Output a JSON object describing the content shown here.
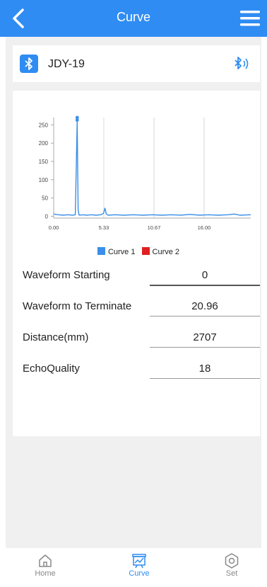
{
  "header": {
    "title": "Curve",
    "back_icon": "chevron-left-icon",
    "menu_icon": "hamburger-menu-icon"
  },
  "device": {
    "name": "JDY-19",
    "icon": "bluetooth-icon",
    "status_icon": "bluetooth-connected-icon"
  },
  "chart_data": {
    "type": "line",
    "title": "",
    "xlabel": "",
    "ylabel": "",
    "x_ticks": [
      "0.00",
      "5.33",
      "10.67",
      "16.00"
    ],
    "y_ticks": [
      "0",
      "50",
      "100",
      "150",
      "200",
      "250"
    ],
    "xlim": [
      0,
      20.96
    ],
    "ylim": [
      -5,
      270
    ],
    "grid": "vertical",
    "legend_position": "bottom-center",
    "series": [
      {
        "name": "Curve 1",
        "color": "#3b8fe8",
        "x": [
          0,
          0.5,
          1.0,
          1.5,
          2.0,
          2.3,
          2.5,
          2.6,
          2.7,
          2.8,
          2.9,
          3.1,
          3.5,
          4.0,
          4.5,
          5.0,
          5.3,
          5.45,
          5.6,
          5.8,
          6.5,
          7.5,
          8.5,
          9.5,
          10.5,
          11.5,
          12.5,
          13.5,
          14.5,
          15.5,
          16.5,
          17.5,
          18.5,
          19.2,
          19.8,
          20.96
        ],
        "y": [
          6,
          4,
          3,
          4,
          3,
          4,
          262,
          18,
          3,
          4,
          3,
          4,
          3,
          4,
          3,
          4,
          8,
          22,
          6,
          3,
          4,
          3,
          4,
          3,
          4,
          3,
          4,
          3,
          5,
          3,
          4,
          3,
          4,
          6,
          3,
          4
        ]
      },
      {
        "name": "Curve 2",
        "color": "#e02020",
        "x": [],
        "y": []
      }
    ],
    "markers": [
      {
        "x": 2.5,
        "y": 270
      },
      {
        "x": 2.5,
        "y": 263
      }
    ]
  },
  "fields": [
    {
      "label": "Waveform Starting",
      "value": "0"
    },
    {
      "label": "Waveform to Terminate",
      "value": "20.96"
    },
    {
      "label": "Distance(mm)",
      "value": "2707"
    },
    {
      "label": "EchoQuality",
      "value": "18"
    }
  ],
  "tabs": [
    {
      "label": "Home",
      "icon": "home-icon"
    },
    {
      "label": "Curve",
      "icon": "chart-icon"
    },
    {
      "label": "Set",
      "icon": "settings-hex-icon"
    }
  ],
  "colors": {
    "accent": "#2f8cf2",
    "background": "#f0f0f0",
    "curve1": "#3b8fe8",
    "curve2": "#e02020"
  }
}
